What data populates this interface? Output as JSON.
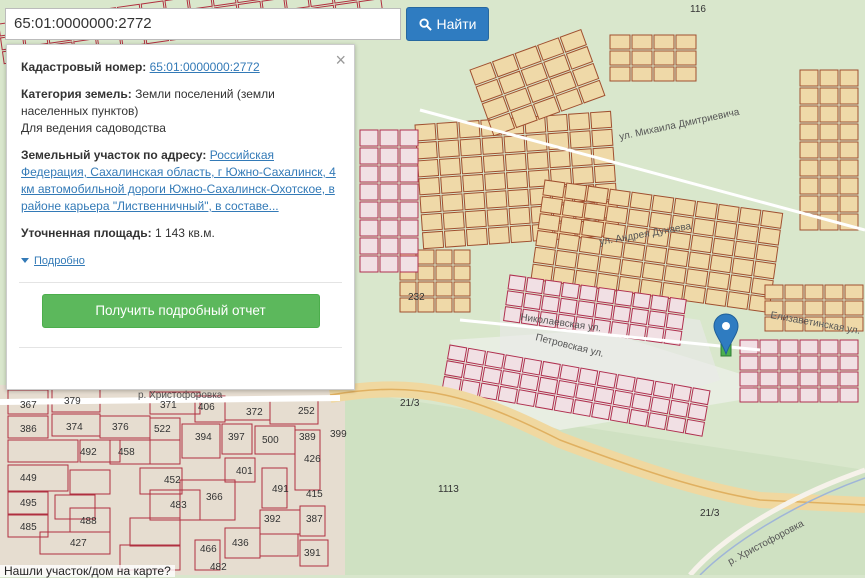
{
  "search": {
    "value": "65:01:0000000:2772",
    "button_label": "Найти",
    "button_icon": "search-icon"
  },
  "info_panel": {
    "cadastral_label": "Кадастровый номер:",
    "cadastral_value": "65:01:0000000:2772",
    "category_label": "Категория земель:",
    "category_value": "Земли поселений (земли населенных пунктов)",
    "usage": "Для ведения садоводства",
    "address_label": "Земельный участок по адресу:",
    "address_value": "Российская Федерация, Сахалинская область, г Южно-Сахалинск, 4 км автомобильной дороги Южно-Сахалинск-Охотское, в районе карьера \"Лиственничный\", в составе...",
    "area_label": "Уточненная площадь:",
    "area_value": "1 143 кв.м.",
    "details_link": "Подробно",
    "report_button": "Получить подробный отчет",
    "close_icon": "close-icon"
  },
  "map": {
    "parcel_numbers": [
      "116",
      "367",
      "379",
      "371",
      "406",
      "372",
      "252",
      "386",
      "374",
      "376",
      "522",
      "394",
      "397",
      "500",
      "389",
      "399",
      "492",
      "458",
      "426",
      "449",
      "452",
      "401",
      "491",
      "495",
      "483",
      "366",
      "415",
      "485",
      "488",
      "392",
      "387",
      "427",
      "466",
      "436",
      "391",
      "482",
      "232"
    ],
    "road_labels": [
      "21/3",
      "21/3",
      "1113"
    ],
    "street_labels": [
      "ул. Михаила Дмитриевича",
      "ул. Андрея Дунаева",
      "Елизаветинская ул.",
      "Николаевская ул.",
      "Петровская ул.",
      "р. Христофоровка",
      "р. Христофоровка"
    ],
    "marker_icon": "map-pin-icon"
  },
  "bottom_prompt": "Нашли участок/дом на карте?",
  "colors": {
    "search_button": "#2f7cc1",
    "report_button": "#5cb85c",
    "link": "#337ab7",
    "marker": "#2f7cc1",
    "parcel_line": "#b03040"
  }
}
